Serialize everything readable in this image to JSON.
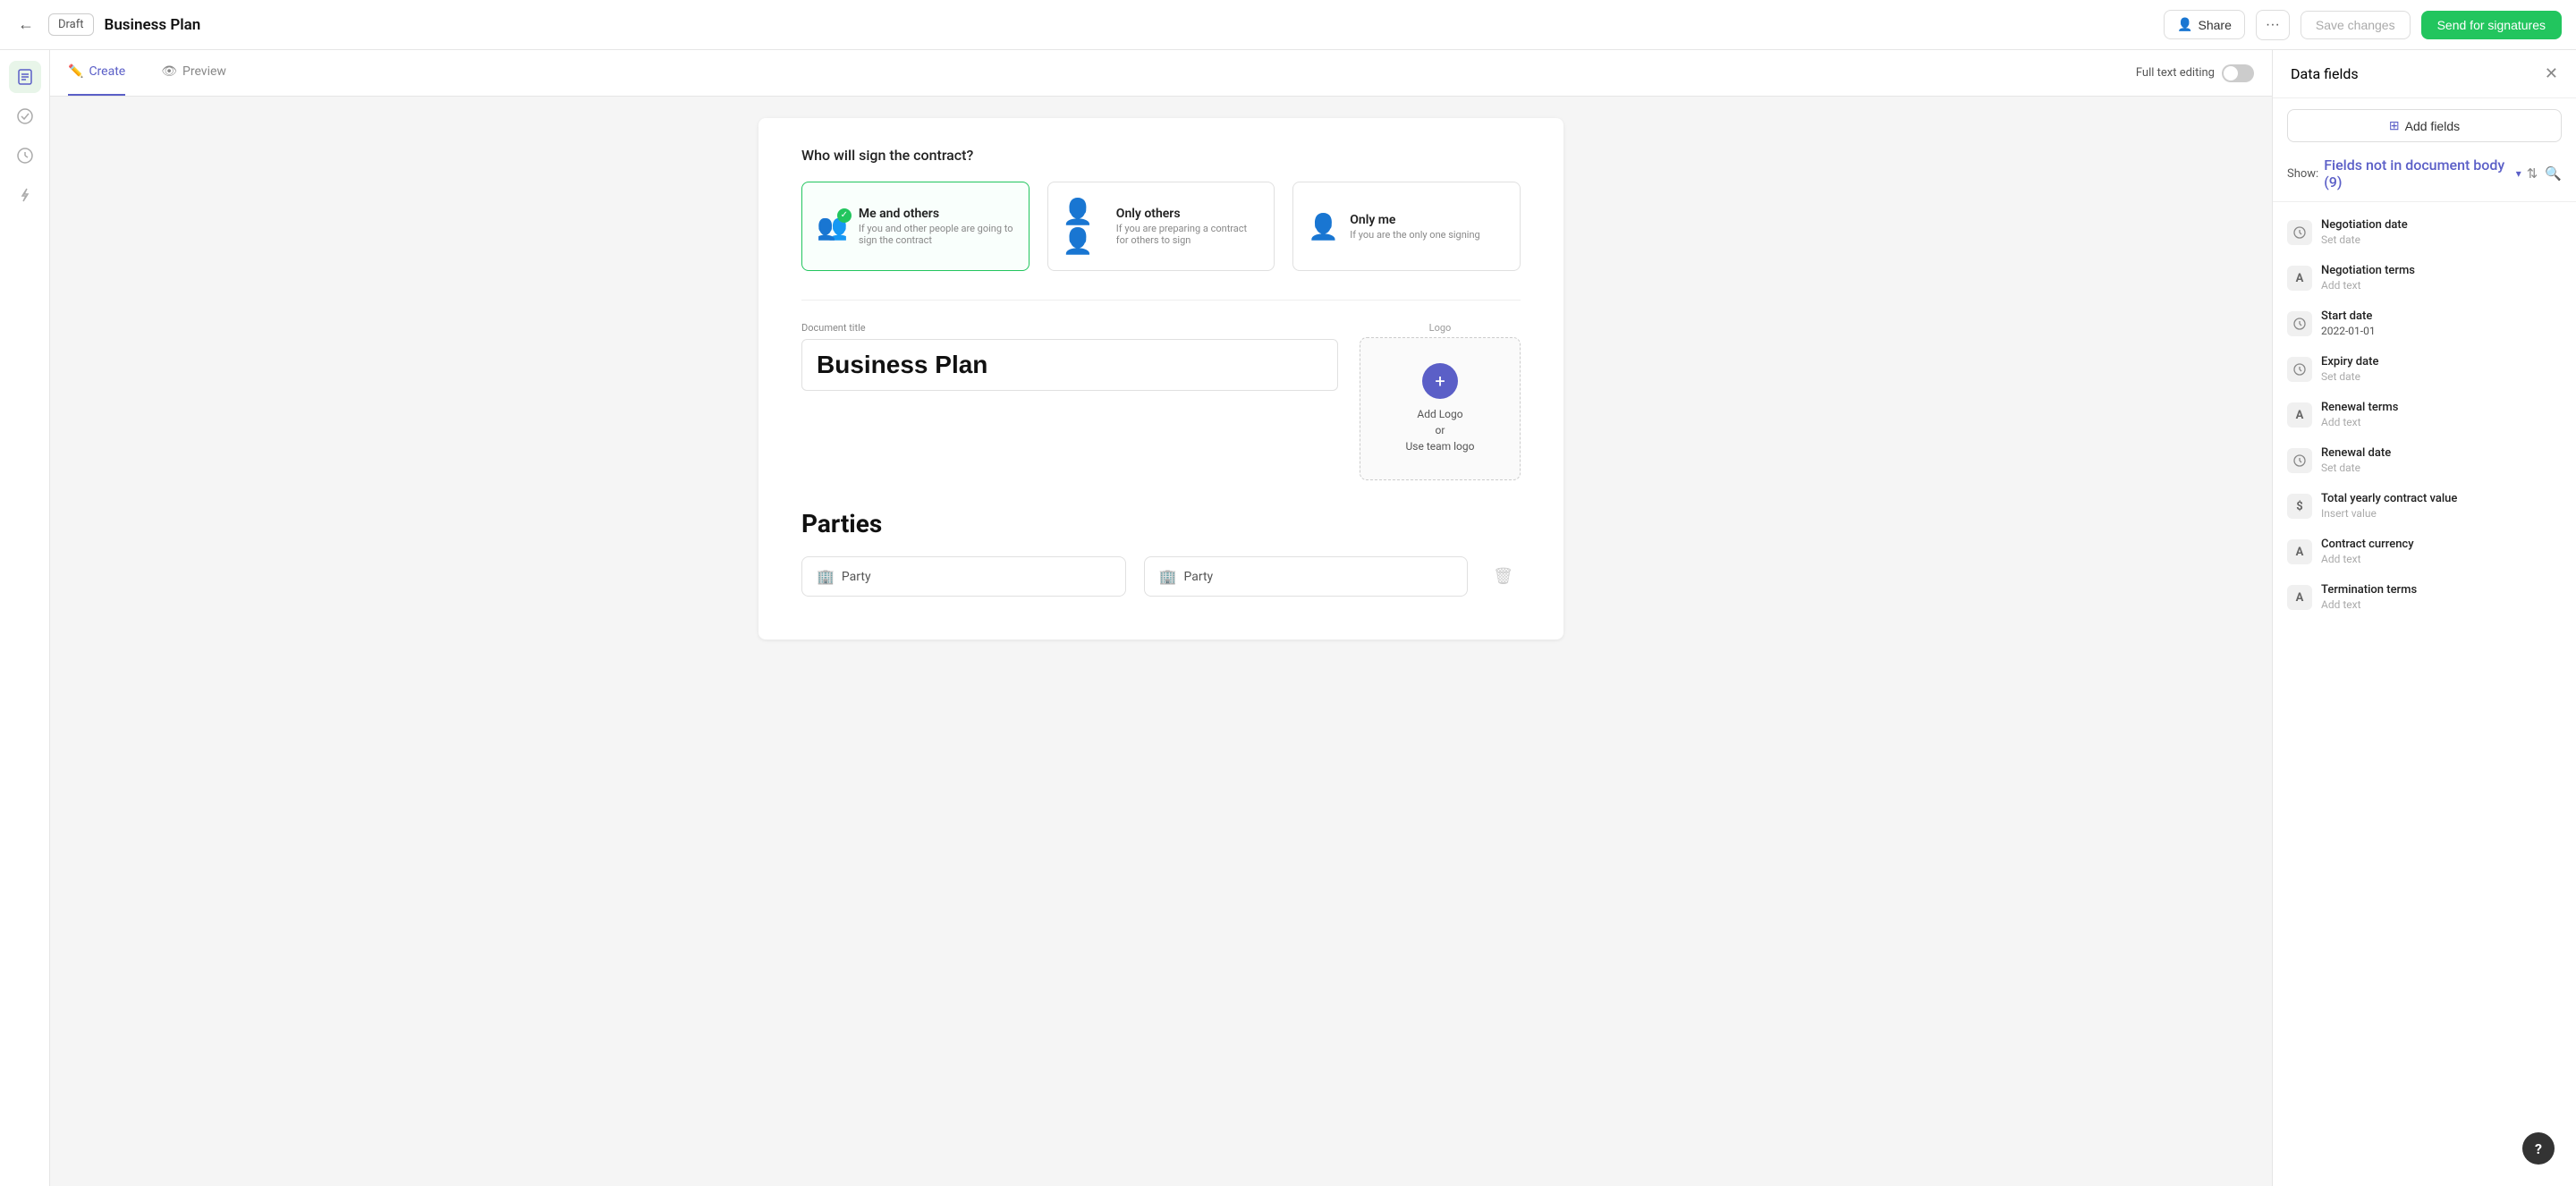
{
  "topbar": {
    "back_icon": "←",
    "draft_label": "Draft",
    "doc_title": "Business Plan",
    "share_label": "Share",
    "more_icon": "···",
    "save_label": "Save changes",
    "send_label": "Send for signatures"
  },
  "toolbar": {
    "create_tab": "Create",
    "preview_tab": "Preview",
    "full_text_editing_label": "Full text editing"
  },
  "signers": {
    "question": "Who will sign the contract?",
    "options": [
      {
        "id": "me-and-others",
        "label": "Me and others",
        "description": "If you and other people are going to sign the contract",
        "selected": true
      },
      {
        "id": "only-others",
        "label": "Only others",
        "description": "If you are preparing a contract for others to sign",
        "selected": false
      },
      {
        "id": "only-me",
        "label": "Only me",
        "description": "If you are the only one signing",
        "selected": false
      }
    ]
  },
  "document": {
    "logo_label": "Logo",
    "logo_add_text": "Add Logo\nor\nUse team logo",
    "title_label": "Document title",
    "title_value": "Business Plan",
    "parties_title": "Parties",
    "party1_label": "Party",
    "party2_label": "Party"
  },
  "right_panel": {
    "title": "Data fields",
    "add_fields_label": "Add fields",
    "filter_prefix": "Show:",
    "filter_value": "Fields not in document body (9)",
    "fields": [
      {
        "id": "negotiation-date",
        "name": "Negotiation date",
        "value": "Set date",
        "icon": "🕐",
        "type": "date"
      },
      {
        "id": "negotiation-terms",
        "name": "Negotiation terms",
        "value": "Add text",
        "icon": "A",
        "type": "text"
      },
      {
        "id": "start-date",
        "name": "Start date",
        "value": "2022-01-01",
        "icon": "🕐",
        "type": "date",
        "is_set": true
      },
      {
        "id": "expiry-date",
        "name": "Expiry date",
        "value": "Set date",
        "icon": "🕐",
        "type": "date"
      },
      {
        "id": "renewal-terms",
        "name": "Renewal terms",
        "value": "Add text",
        "icon": "A",
        "type": "text"
      },
      {
        "id": "renewal-date",
        "name": "Renewal date",
        "value": "Set date",
        "icon": "🕐",
        "type": "date"
      },
      {
        "id": "total-yearly-contract-value",
        "name": "Total yearly contract value",
        "value": "Insert value",
        "icon": "$",
        "type": "number"
      },
      {
        "id": "contract-currency",
        "name": "Contract currency",
        "value": "Add text",
        "icon": "A",
        "type": "text"
      },
      {
        "id": "termination-terms",
        "name": "Termination terms",
        "value": "Add text",
        "icon": "A",
        "type": "text"
      }
    ]
  },
  "help": {
    "icon": "?"
  }
}
